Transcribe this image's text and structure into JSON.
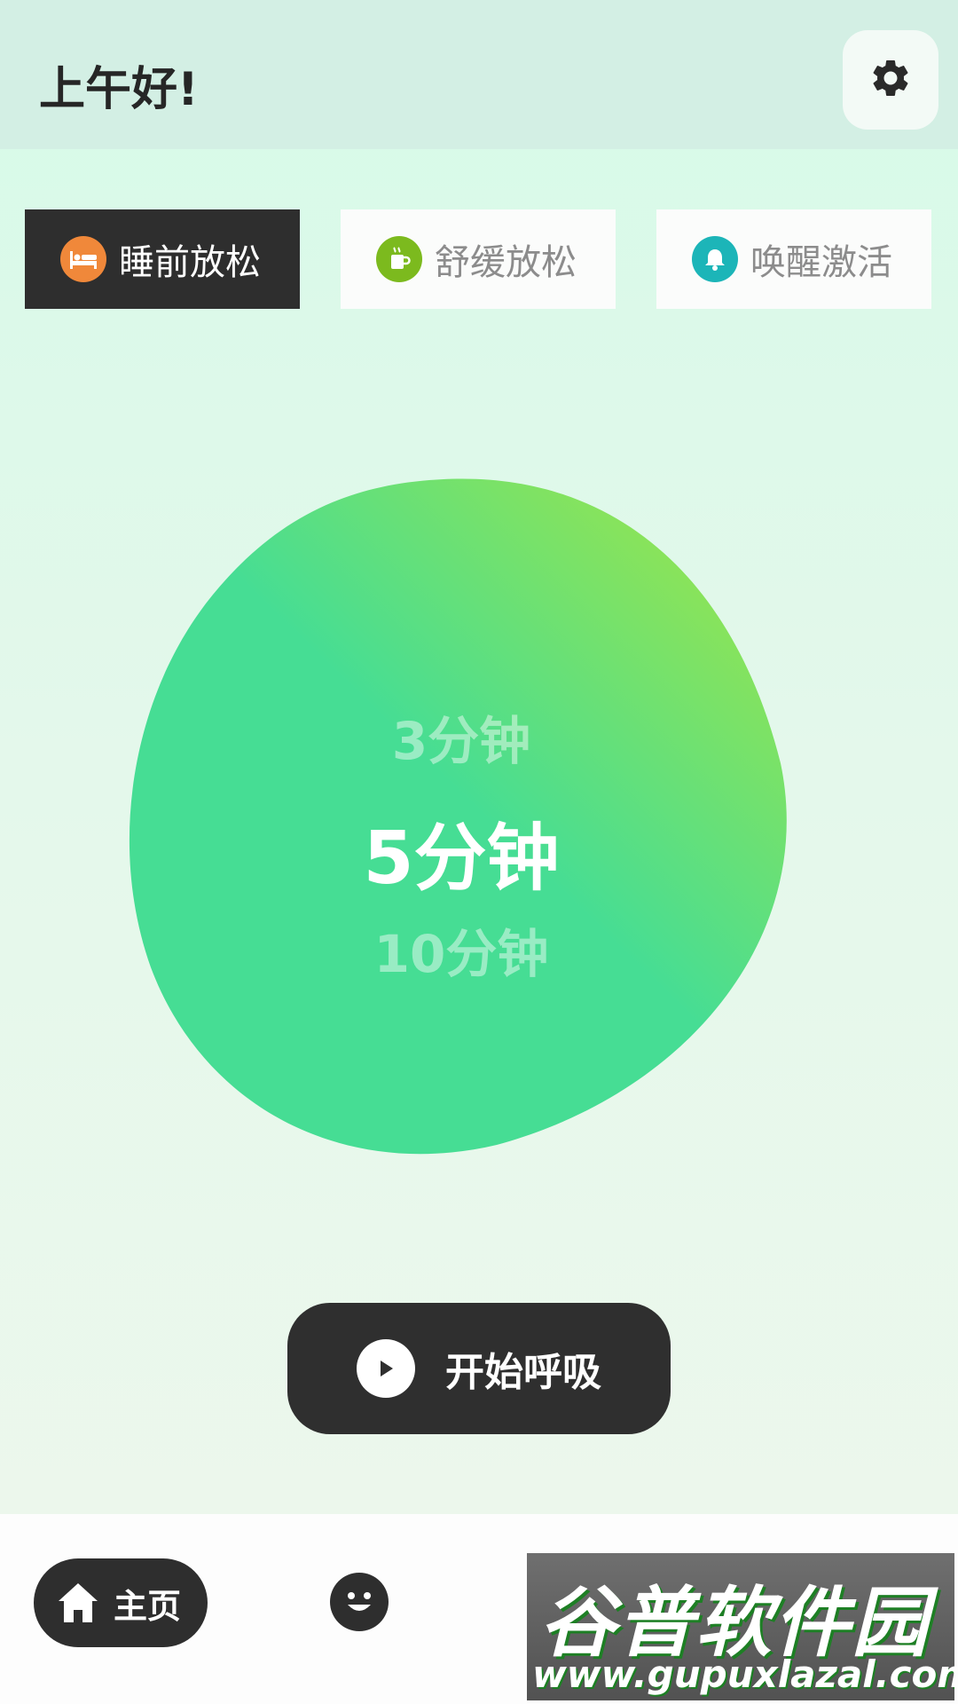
{
  "header": {
    "greeting": "上午好!"
  },
  "modes": [
    {
      "label": "睡前放松",
      "icon": "bed-icon",
      "color": "#f0883a",
      "active": true
    },
    {
      "label": "舒缓放松",
      "icon": "coffee-cup-icon",
      "color": "#7cba1e",
      "active": false
    },
    {
      "label": "唤醒激活",
      "icon": "bell-icon",
      "color": "#1cb5b8",
      "active": false
    }
  ],
  "durations": {
    "above": "3分钟",
    "selected": "5分钟",
    "below": "10分钟"
  },
  "start_button": {
    "label": "开始呼吸"
  },
  "bottom_nav": {
    "home_label": "主页",
    "home_icon": "home-icon",
    "mood_icon": "smiley-icon"
  },
  "watermark": {
    "title": "谷普软件园",
    "url": "www.gupuxlazal.com"
  },
  "colors": {
    "blob_start": "#9de64a",
    "blob_end": "#46dd94",
    "dark": "#2e2e2e"
  }
}
